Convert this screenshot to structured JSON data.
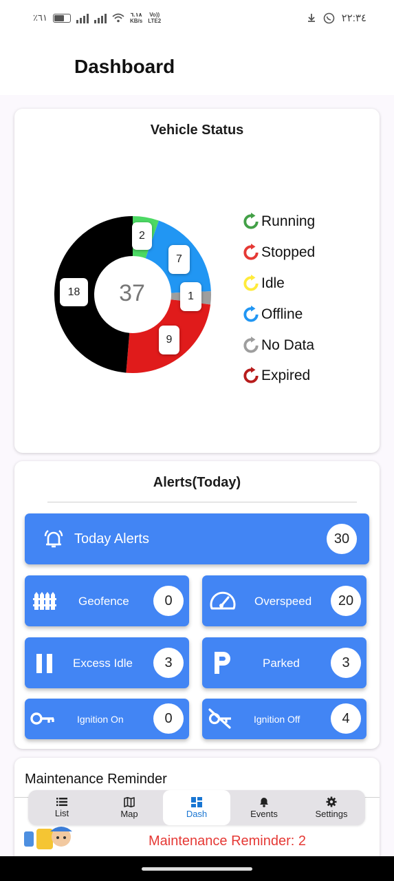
{
  "status_bar": {
    "battery": "٪٦١",
    "speed": "٦.١٨",
    "speed_unit": "KB/s",
    "network_top": "Vo))",
    "network_bottom": "LTE2",
    "time": "٢٢:٣٤"
  },
  "app": {
    "title": "Dashboard"
  },
  "vehicle_status": {
    "title": "Vehicle Status",
    "total": "37",
    "legend": [
      {
        "label": "Running",
        "color": "#43a047"
      },
      {
        "label": "Stopped",
        "color": "#e53935"
      },
      {
        "label": "Idle",
        "color": "#ffeb3b"
      },
      {
        "label": "Offline",
        "color": "#2196f3"
      },
      {
        "label": "No Data",
        "color": "#9e9e9e"
      },
      {
        "label": "Expired",
        "color": "#b71c1c"
      }
    ],
    "segments": [
      {
        "name": "Running",
        "value": 2,
        "label": "2",
        "color": "#4cd964"
      },
      {
        "name": "Offline",
        "value": 7,
        "label": "7",
        "color": "#2196f3"
      },
      {
        "name": "No Data",
        "value": 1,
        "label": "1",
        "color": "#9e9e9e"
      },
      {
        "name": "Stopped",
        "value": 9,
        "label": "9",
        "color": "#e01b1b"
      },
      {
        "name": "Expired",
        "value": 18,
        "label": "18",
        "color": "#000000"
      }
    ]
  },
  "alerts": {
    "title": "Alerts(Today)",
    "today_label": "Today Alerts",
    "today_count": "30",
    "geofence_label": "Geofence",
    "geofence_count": "0",
    "overspeed_label": "Overspeed",
    "overspeed_count": "20",
    "excess_idle_label": "Excess Idle",
    "excess_idle_count": "3",
    "parked_label": "Parked",
    "parked_count": "3",
    "ignition_on_label": "Ignition On",
    "ignition_on_count": "0",
    "ignition_off_label": "Ignition Off",
    "ignition_off_count": "4"
  },
  "maintenance": {
    "title": "Maintenance Reminder",
    "reminder": "Maintenance Reminder: 2"
  },
  "nav": {
    "list": "List",
    "map": "Map",
    "dash": "Dash",
    "events": "Events",
    "settings": "Settings",
    "active_color": "#1976d2"
  }
}
